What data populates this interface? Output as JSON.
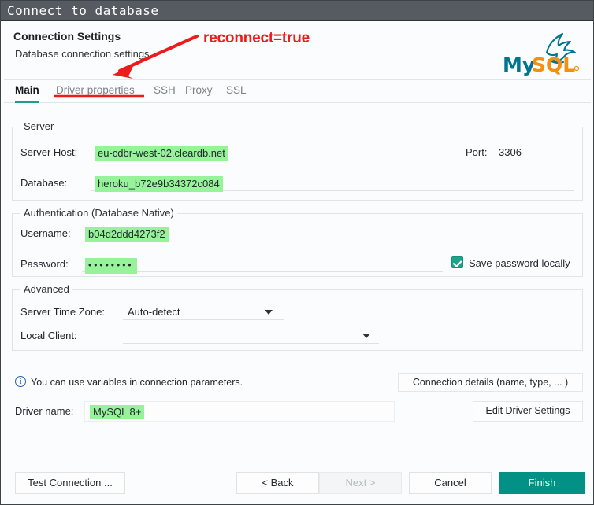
{
  "window": {
    "title": "Connect to database"
  },
  "header": {
    "title": "Connection Settings",
    "subtitle": "Database connection settings",
    "logo_name": "mysql-logo",
    "logo_text_my": "My",
    "logo_text_sql": "SQL"
  },
  "annotation": {
    "text": "reconnect=true",
    "color": "#ee1b1b",
    "points_to": "Driver properties"
  },
  "tabs": [
    {
      "label": "Main",
      "active": true
    },
    {
      "label": "Driver properties",
      "active": false
    },
    {
      "label": "SSH",
      "active": false
    },
    {
      "label": "Proxy",
      "active": false
    },
    {
      "label": "SSL",
      "active": false
    }
  ],
  "server_group": {
    "label": "Server",
    "host_label": "Server Host:",
    "host_value": "eu-cdbr-west-02.cleardb.net",
    "port_label": "Port:",
    "port_value": "3306",
    "database_label": "Database:",
    "database_value": "heroku_b72e9b34372c084"
  },
  "auth_group": {
    "label": "Authentication (Database Native)",
    "username_label": "Username:",
    "username_value": "b04d2ddd4273f2",
    "password_label": "Password:",
    "password_value": "••••••••",
    "save_password_label": "Save password locally",
    "save_password_checked": true
  },
  "advanced_group": {
    "label": "Advanced",
    "timezone_label": "Server Time Zone:",
    "timezone_value": "Auto-detect",
    "local_client_label": "Local Client:",
    "local_client_value": ""
  },
  "info": {
    "icon": "info-circle-icon",
    "text": "You can use variables in connection parameters.",
    "connection_details_label": "Connection details (name, type, ... )"
  },
  "driver": {
    "label": "Driver name:",
    "value": "MySQL 8+",
    "edit_label": "Edit Driver Settings"
  },
  "footer": {
    "test_connection_label": "Test Connection ...",
    "back_label": "< Back",
    "next_label": "Next >",
    "next_disabled": true,
    "cancel_label": "Cancel",
    "finish_label": "Finish"
  },
  "colors": {
    "accent_teal": "#029184",
    "tab_underline": "#1e9e86",
    "highlight_green": "#96f39a",
    "annotation_red": "#ee1b1b",
    "titlebar": "#555b60"
  }
}
